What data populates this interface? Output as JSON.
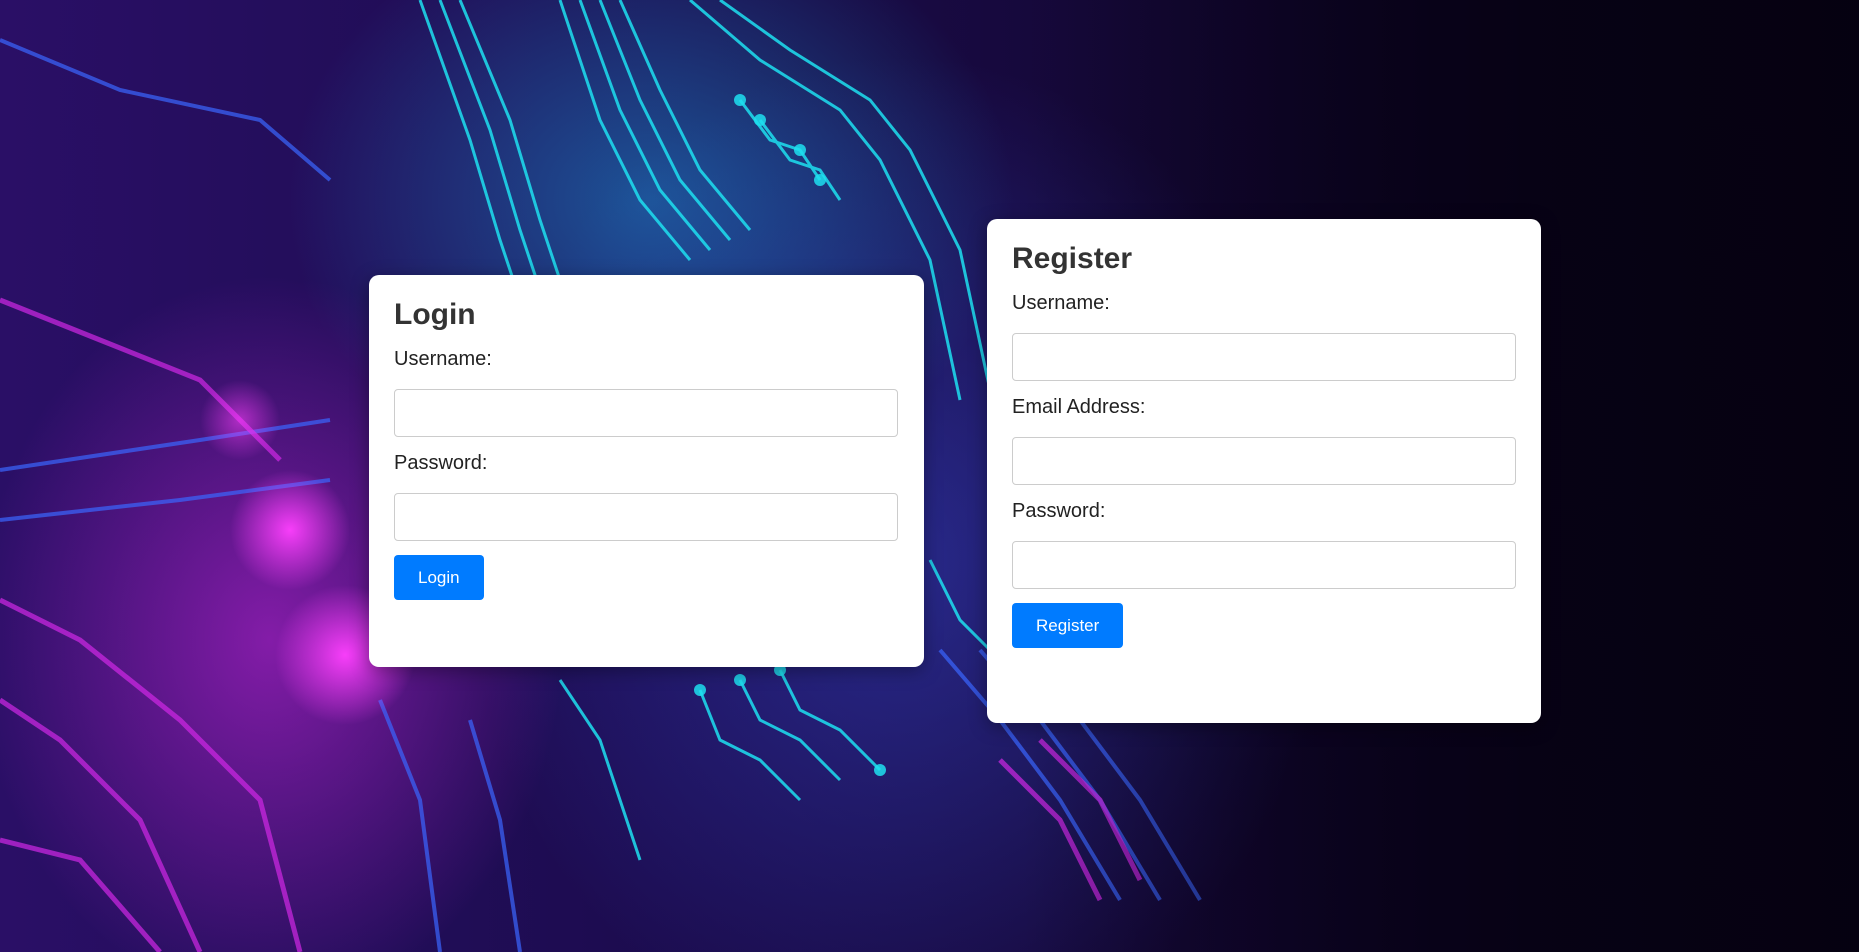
{
  "login": {
    "title": "Login",
    "username_label": "Username:",
    "username_value": "",
    "password_label": "Password:",
    "password_value": "",
    "submit_label": "Login"
  },
  "register": {
    "title": "Register",
    "username_label": "Username:",
    "username_value": "",
    "email_label": "Email Address:",
    "email_value": "",
    "password_label": "Password:",
    "password_value": "",
    "submit_label": "Register"
  },
  "colors": {
    "button": "#007bff",
    "panel": "#ffffff",
    "heading": "#333333",
    "background_accent_cyan": "#1ee0f0",
    "background_accent_magenta": "#d028e6",
    "background_dark": "#0b0320"
  },
  "background": {
    "image": "circuit-board-background"
  }
}
